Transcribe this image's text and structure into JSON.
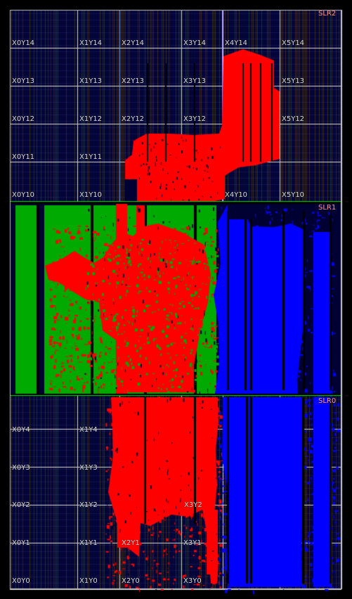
{
  "view": {
    "name": "device-floorplan-view",
    "slr_labels": [
      "SLR2",
      "SLR1",
      "SLR0"
    ],
    "clock_region_labels": [
      [
        "X0Y14",
        "X1Y14",
        "X2Y14",
        "X3Y14",
        "X4Y14",
        "X5Y14"
      ],
      [
        "X0Y13",
        "X1Y13",
        "X2Y13",
        "X3Y13",
        "",
        "X5Y13"
      ],
      [
        "X0Y12",
        "X1Y12",
        "X2Y12",
        "X3Y12",
        "",
        "X5Y12"
      ],
      [
        "X0Y11",
        "X1Y11",
        "",
        "",
        "",
        ""
      ],
      [
        "X0Y10",
        "X1Y10",
        "",
        "",
        "X4Y10",
        "X5Y10"
      ],
      [
        "",
        "",
        "",
        "",
        "",
        ""
      ],
      [
        "",
        "",
        "",
        "",
        "",
        ""
      ],
      [
        "",
        "",
        "",
        "",
        "",
        ""
      ],
      [
        "",
        "",
        "",
        "",
        "",
        ""
      ],
      [
        "",
        "",
        "",
        "",
        "",
        ""
      ],
      [
        "X0Y4",
        "X1Y4",
        "",
        "",
        "",
        ""
      ],
      [
        "X0Y3",
        "X1Y3",
        "",
        "",
        "",
        ""
      ],
      [
        "X0Y2",
        "X1Y2",
        "",
        "X3Y2",
        "",
        ""
      ],
      [
        "X0Y1",
        "X1Y1",
        "X2Y1",
        "X3Y1",
        "",
        ""
      ],
      [
        "X0Y0",
        "X1Y0",
        "X2Y0",
        "X3Y0",
        "",
        ""
      ]
    ],
    "colors": {
      "background": "#000000",
      "fabric": "#000033",
      "grid_lines": "#d8d8d8",
      "slr_boundary": "#00dd00",
      "red_region": "#ff0000",
      "green_region": "#00aa00",
      "blue_region": "#0000ff",
      "label_text": "#d9d9d9",
      "slr_label_text": "#ff9999"
    }
  }
}
